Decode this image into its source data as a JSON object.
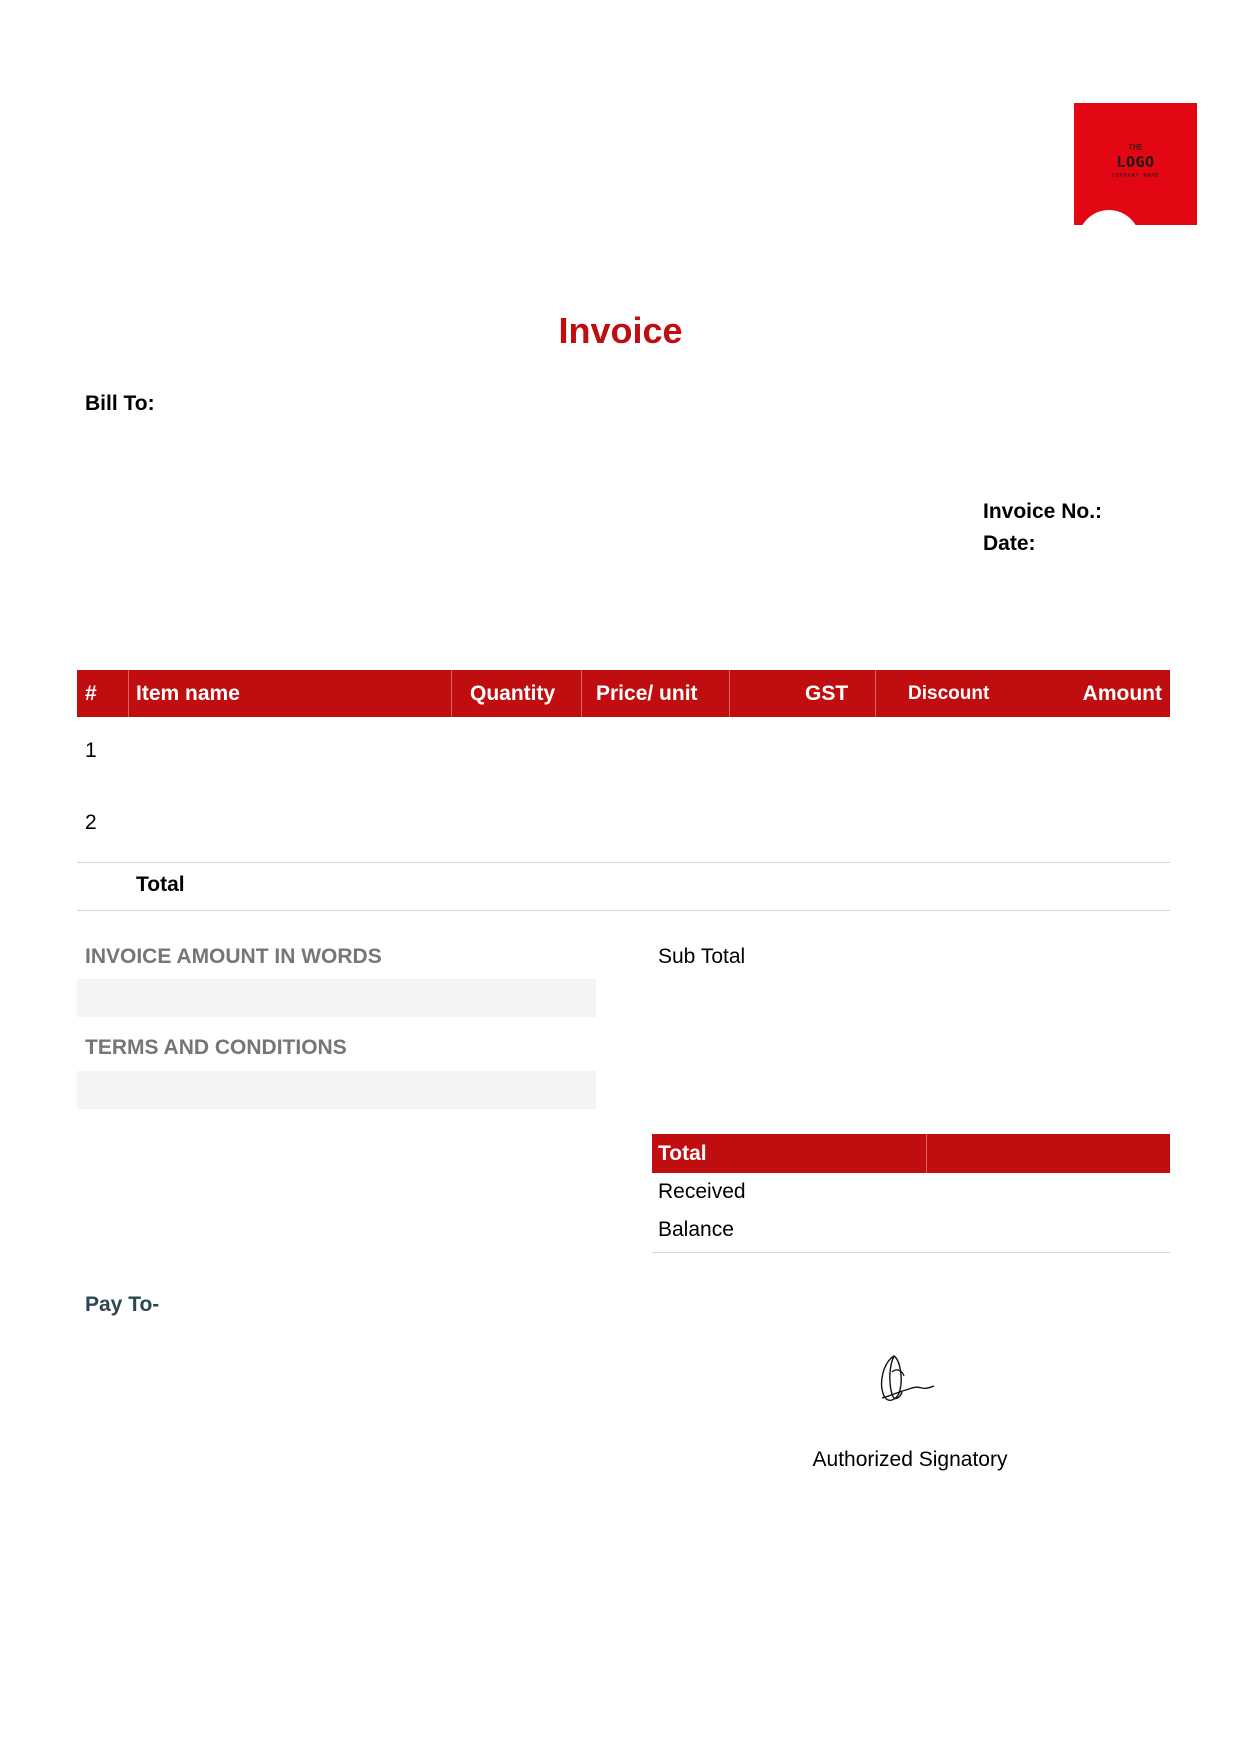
{
  "logo": {
    "line1": "THE",
    "line2": "LOGO",
    "line3": "COMPANY NAME",
    "line4": "· · ·"
  },
  "title": "Invoice",
  "bill_to_label": "Bill To:",
  "invoice_no_label": "Invoice No.:",
  "date_label": "Date:",
  "table": {
    "headers": [
      "#",
      "Item name",
      "Quantity",
      "Price/ unit",
      "GST",
      "Discount",
      "Amount"
    ],
    "rows": [
      "1",
      "2"
    ],
    "total_label": "Total"
  },
  "left_sections": {
    "amount_words_label": "INVOICE AMOUNT IN WORDS",
    "terms_label": "TERMS AND CONDITIONS"
  },
  "summary": {
    "sub_total_label": "Sub Total",
    "total_label": "Total",
    "received_label": "Received",
    "balance_label": "Balance"
  },
  "pay_to_label": "Pay To-",
  "signatory_label": "Authorized Signatory",
  "colors": {
    "accent": "#c00d10",
    "logo_red": "#e30613",
    "muted": "#767676",
    "pay_to": "#2c4754"
  }
}
